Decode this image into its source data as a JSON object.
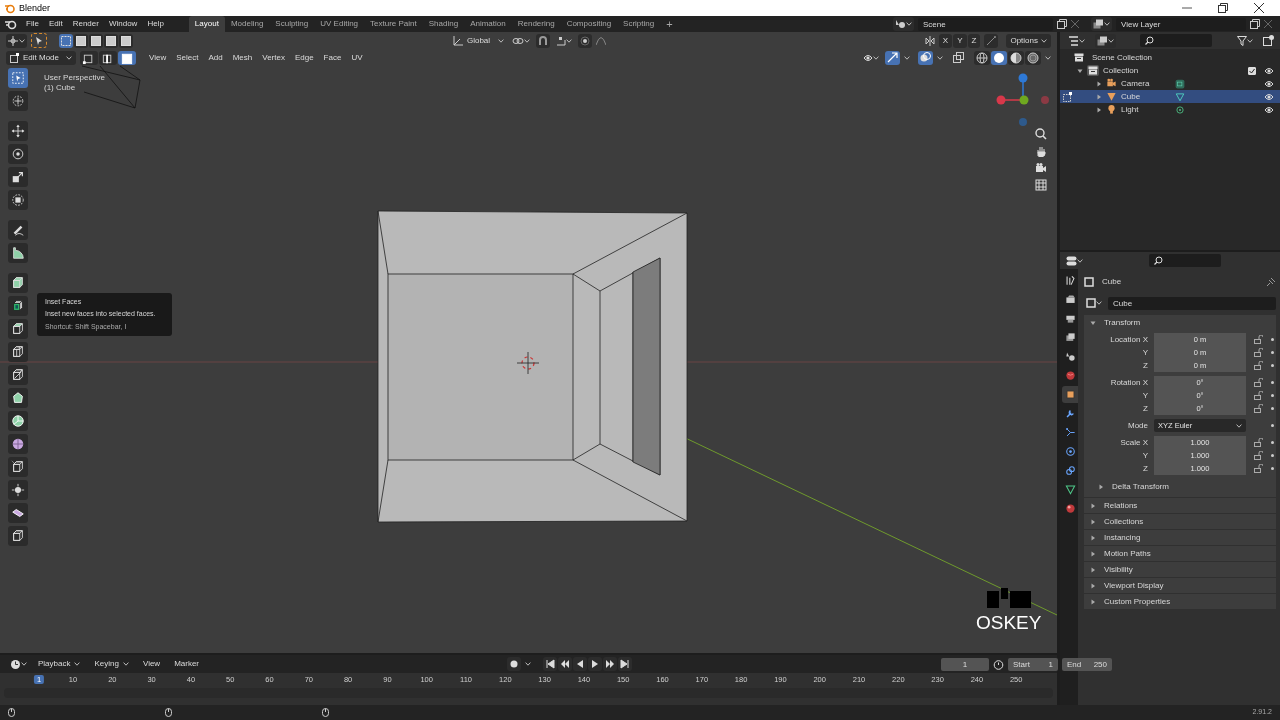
{
  "window": {
    "title": "Blender"
  },
  "menu": [
    "File",
    "Edit",
    "Render",
    "Window",
    "Help"
  ],
  "workspaces": [
    {
      "label": "Layout",
      "selected": true
    },
    {
      "label": "Modeling",
      "selected": false
    },
    {
      "label": "Sculpting",
      "selected": false
    },
    {
      "label": "UV Editing",
      "selected": false
    },
    {
      "label": "Texture Paint",
      "selected": false
    },
    {
      "label": "Shading",
      "selected": false
    },
    {
      "label": "Animation",
      "selected": false
    },
    {
      "label": "Rendering",
      "selected": false
    },
    {
      "label": "Compositing",
      "selected": false
    },
    {
      "label": "Scripting",
      "selected": false
    }
  ],
  "add_workspace": "+",
  "scene": "Scene",
  "view_layer": "View Layer",
  "tool_settings": {
    "orientation": "Global",
    "mirror_axes": [
      "X",
      "Y",
      "Z"
    ],
    "options": "Options"
  },
  "viewport_header": {
    "mode": "Edit Mode",
    "select_modes": [
      {
        "kind": "vertex",
        "selected": false
      },
      {
        "kind": "edge",
        "selected": false
      },
      {
        "kind": "face",
        "selected": true
      }
    ],
    "menus": [
      "View",
      "Select",
      "Add",
      "Mesh",
      "Vertex",
      "Edge",
      "Face",
      "UV"
    ],
    "shading": [
      {
        "kind": "wireframe",
        "selected": false
      },
      {
        "kind": "solid",
        "selected": true
      },
      {
        "kind": "material",
        "selected": false
      },
      {
        "kind": "rendered",
        "selected": false
      }
    ]
  },
  "viewport": {
    "perspective": "User Perspective",
    "object": "(1) Cube",
    "screencast_key": "OSKEY"
  },
  "toolbar": [
    {
      "kind": "select",
      "selected": true
    },
    {
      "kind": "cursor",
      "selected": false
    },
    {
      "kind": "move",
      "selected": false
    },
    {
      "kind": "rotate",
      "selected": false
    },
    {
      "kind": "scale",
      "selected": false
    },
    {
      "kind": "transform",
      "selected": false
    },
    {
      "kind": "annotate",
      "selected": false
    },
    {
      "kind": "measure",
      "selected": false
    },
    {
      "kind": "extrude",
      "selected": false
    },
    {
      "kind": "inset",
      "selected": false
    },
    {
      "kind": "bevel",
      "selected": false
    },
    {
      "kind": "loopcut",
      "selected": false
    },
    {
      "kind": "knife",
      "selected": false
    },
    {
      "kind": "polybuild",
      "selected": false
    },
    {
      "kind": "spin",
      "selected": false
    },
    {
      "kind": "smooth",
      "selected": false
    },
    {
      "kind": "edgeslide",
      "selected": false
    },
    {
      "kind": "shrink",
      "selected": false
    },
    {
      "kind": "shear",
      "selected": false
    },
    {
      "kind": "rip",
      "selected": false
    }
  ],
  "tooltip": {
    "title": "Inset Faces",
    "description": "Inset new faces into selected faces.",
    "shortcut": "Shortcut: Shift Spacebar, I"
  },
  "outliner": {
    "root": "Scene Collection",
    "collection": {
      "label": "Collection",
      "expanded": true,
      "checked": true,
      "children": [
        {
          "label": "Camera",
          "kind": "camera",
          "selected": false,
          "expanded": false
        },
        {
          "label": "Cube",
          "kind": "mesh",
          "selected": true,
          "expanded": false
        },
        {
          "label": "Light",
          "kind": "light",
          "selected": false,
          "expanded": false
        }
      ]
    }
  },
  "properties": {
    "tabs": [
      {
        "kind": "tool",
        "selected": false
      },
      {
        "kind": "render",
        "selected": false
      },
      {
        "kind": "output",
        "selected": false
      },
      {
        "kind": "view_layer",
        "selected": false
      },
      {
        "kind": "scene",
        "selected": false
      },
      {
        "kind": "world",
        "selected": false
      },
      {
        "kind": "object",
        "selected": true
      },
      {
        "kind": "modifiers",
        "selected": false
      },
      {
        "kind": "particles",
        "selected": false
      },
      {
        "kind": "physics",
        "selected": false
      },
      {
        "kind": "constraints",
        "selected": false
      },
      {
        "kind": "data",
        "selected": false
      },
      {
        "kind": "material",
        "selected": false
      }
    ],
    "header": "Cube",
    "name": "Cube",
    "transform": {
      "label": "Transform",
      "expanded": true,
      "groups": [
        [
          {
            "label": "Location X",
            "value": "0 m",
            "kind": "number"
          },
          {
            "label": "Y",
            "value": "0 m",
            "kind": "number"
          },
          {
            "label": "Z",
            "value": "0 m",
            "kind": "number"
          }
        ],
        [
          {
            "label": "Rotation X",
            "value": "0°",
            "kind": "number"
          },
          {
            "label": "Y",
            "value": "0°",
            "kind": "number"
          },
          {
            "label": "Z",
            "value": "0°",
            "kind": "number"
          }
        ],
        [
          {
            "label": "Mode",
            "value": "XYZ Euler",
            "kind": "dropdown"
          }
        ],
        [
          {
            "label": "Scale X",
            "value": "1.000",
            "kind": "number"
          },
          {
            "label": "Y",
            "value": "1.000",
            "kind": "number"
          },
          {
            "label": "Z",
            "value": "1.000",
            "kind": "number"
          }
        ]
      ],
      "subpanels": [
        {
          "label": "Delta Transform",
          "expanded": false
        }
      ]
    },
    "panels": [
      {
        "label": "Relations",
        "expanded": false
      },
      {
        "label": "Collections",
        "expanded": false
      },
      {
        "label": "Instancing",
        "expanded": false
      },
      {
        "label": "Motion Paths",
        "expanded": false
      },
      {
        "label": "Visibility",
        "expanded": false
      },
      {
        "label": "Viewport Display",
        "expanded": false
      },
      {
        "label": "Custom Properties",
        "expanded": false
      }
    ]
  },
  "timeline": {
    "menus": [
      "Playback",
      "Keying",
      "View",
      "Marker"
    ],
    "frame": "1",
    "start_label": "Start",
    "start": "1",
    "end_label": "End",
    "end": "250",
    "ruler": [
      {
        "label": "1",
        "selected": true
      },
      {
        "label": "10",
        "selected": false
      },
      {
        "label": "20",
        "selected": false
      },
      {
        "label": "30",
        "selected": false
      },
      {
        "label": "40",
        "selected": false
      },
      {
        "label": "50",
        "selected": false
      },
      {
        "label": "60",
        "selected": false
      },
      {
        "label": "70",
        "selected": false
      },
      {
        "label": "80",
        "selected": false
      },
      {
        "label": "90",
        "selected": false
      },
      {
        "label": "100",
        "selected": false
      },
      {
        "label": "110",
        "selected": false
      },
      {
        "label": "120",
        "selected": false
      },
      {
        "label": "130",
        "selected": false
      },
      {
        "label": "140",
        "selected": false
      },
      {
        "label": "150",
        "selected": false
      },
      {
        "label": "160",
        "selected": false
      },
      {
        "label": "170",
        "selected": false
      },
      {
        "label": "180",
        "selected": false
      },
      {
        "label": "190",
        "selected": false
      },
      {
        "label": "200",
        "selected": false
      },
      {
        "label": "210",
        "selected": false
      },
      {
        "label": "220",
        "selected": false
      },
      {
        "label": "230",
        "selected": false
      },
      {
        "label": "240",
        "selected": false
      },
      {
        "label": "250",
        "selected": false
      }
    ]
  },
  "status_bar": {
    "version": "2.91.2"
  }
}
